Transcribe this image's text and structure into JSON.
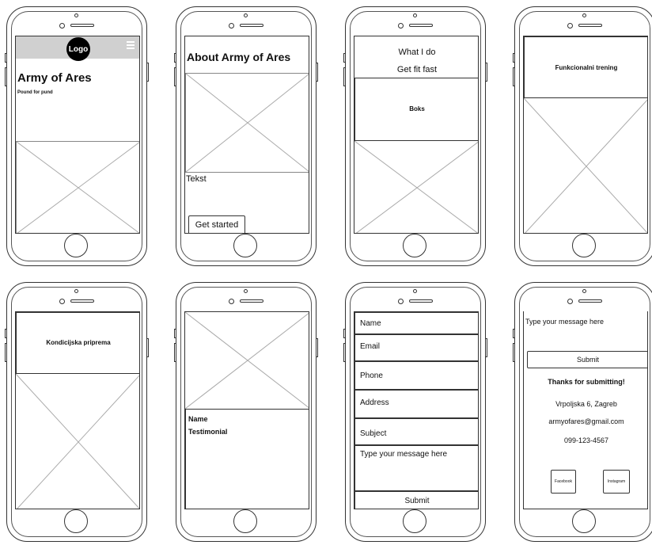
{
  "screen1": {
    "logo": "Logo",
    "menu_icon": "hamburger-menu",
    "title": "Army of Ares",
    "subtitle": "Pound for pund"
  },
  "screen2": {
    "title": "About Army of Ares",
    "text": "Tekst",
    "button": "Get started"
  },
  "screen3": {
    "line1": "What I do",
    "line2": "Get fit fast",
    "section": "Boks"
  },
  "screen4": {
    "section": "Funkcionalni trening"
  },
  "screen5": {
    "section": "Kondicijska priprema"
  },
  "screen6": {
    "name": "Name",
    "testimonial": "Testimonial"
  },
  "screen7": {
    "fields": [
      "Name",
      "Email",
      "Phone",
      "Address",
      "Subject"
    ],
    "message": "Type your message here",
    "submit": "Submit"
  },
  "screen8": {
    "message": "Type your message here",
    "submit": "Submit",
    "thanks": "Thanks for submitting!",
    "address": "Vrpoljska 6, Zagreb",
    "email": "armyofares@gmail.com",
    "phone": "099-123-4567",
    "facebook": "Facebook",
    "instagram": "Instagram"
  }
}
